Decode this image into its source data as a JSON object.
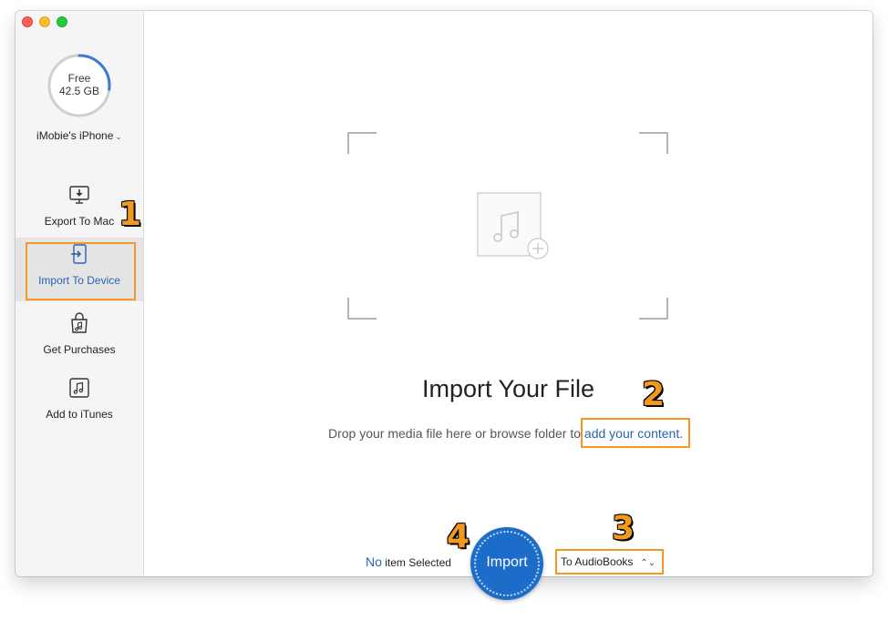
{
  "window": {
    "traffic_lights": {
      "close_color": "#fc5f57",
      "minimize_color": "#fdbc2e",
      "maximize_color": "#28c840"
    }
  },
  "sidebar": {
    "storage": {
      "label": "Free",
      "value": "42.5 GB",
      "used_fraction": 0.27,
      "arc_color": "#3a7bd5",
      "track_color": "#cfcfcf"
    },
    "device": {
      "name": "iMobie's iPhone",
      "chevron": "⌄"
    },
    "nav": [
      {
        "label": "Export To Mac",
        "icon": "monitor-download-icon",
        "active": false
      },
      {
        "label": "Import To Device",
        "icon": "import-arrow-icon",
        "active": true
      },
      {
        "label": "Get Purchases",
        "icon": "shopping-bag-icon",
        "active": false
      },
      {
        "label": "Add to iTunes",
        "icon": "music-note-icon",
        "active": false
      }
    ]
  },
  "main": {
    "drop_area": {
      "icon": "music-add-icon"
    },
    "title": "Import Your File",
    "subtitle_prefix": "Drop your media file here or browse folder to ",
    "subtitle_link": "add your content.",
    "status": {
      "count": "No",
      "text": "item Selected"
    },
    "import_button": "Import",
    "target": {
      "value": "To AudioBooks",
      "arrows": "⌃⌄"
    }
  },
  "annotations": {
    "steps": [
      "1",
      "2",
      "3",
      "4"
    ],
    "highlight_color": "#f39a1e"
  },
  "colors": {
    "accent": "#2a62b3",
    "button": "#1b6dc9",
    "sidebar_bg": "#f5f5f5"
  }
}
